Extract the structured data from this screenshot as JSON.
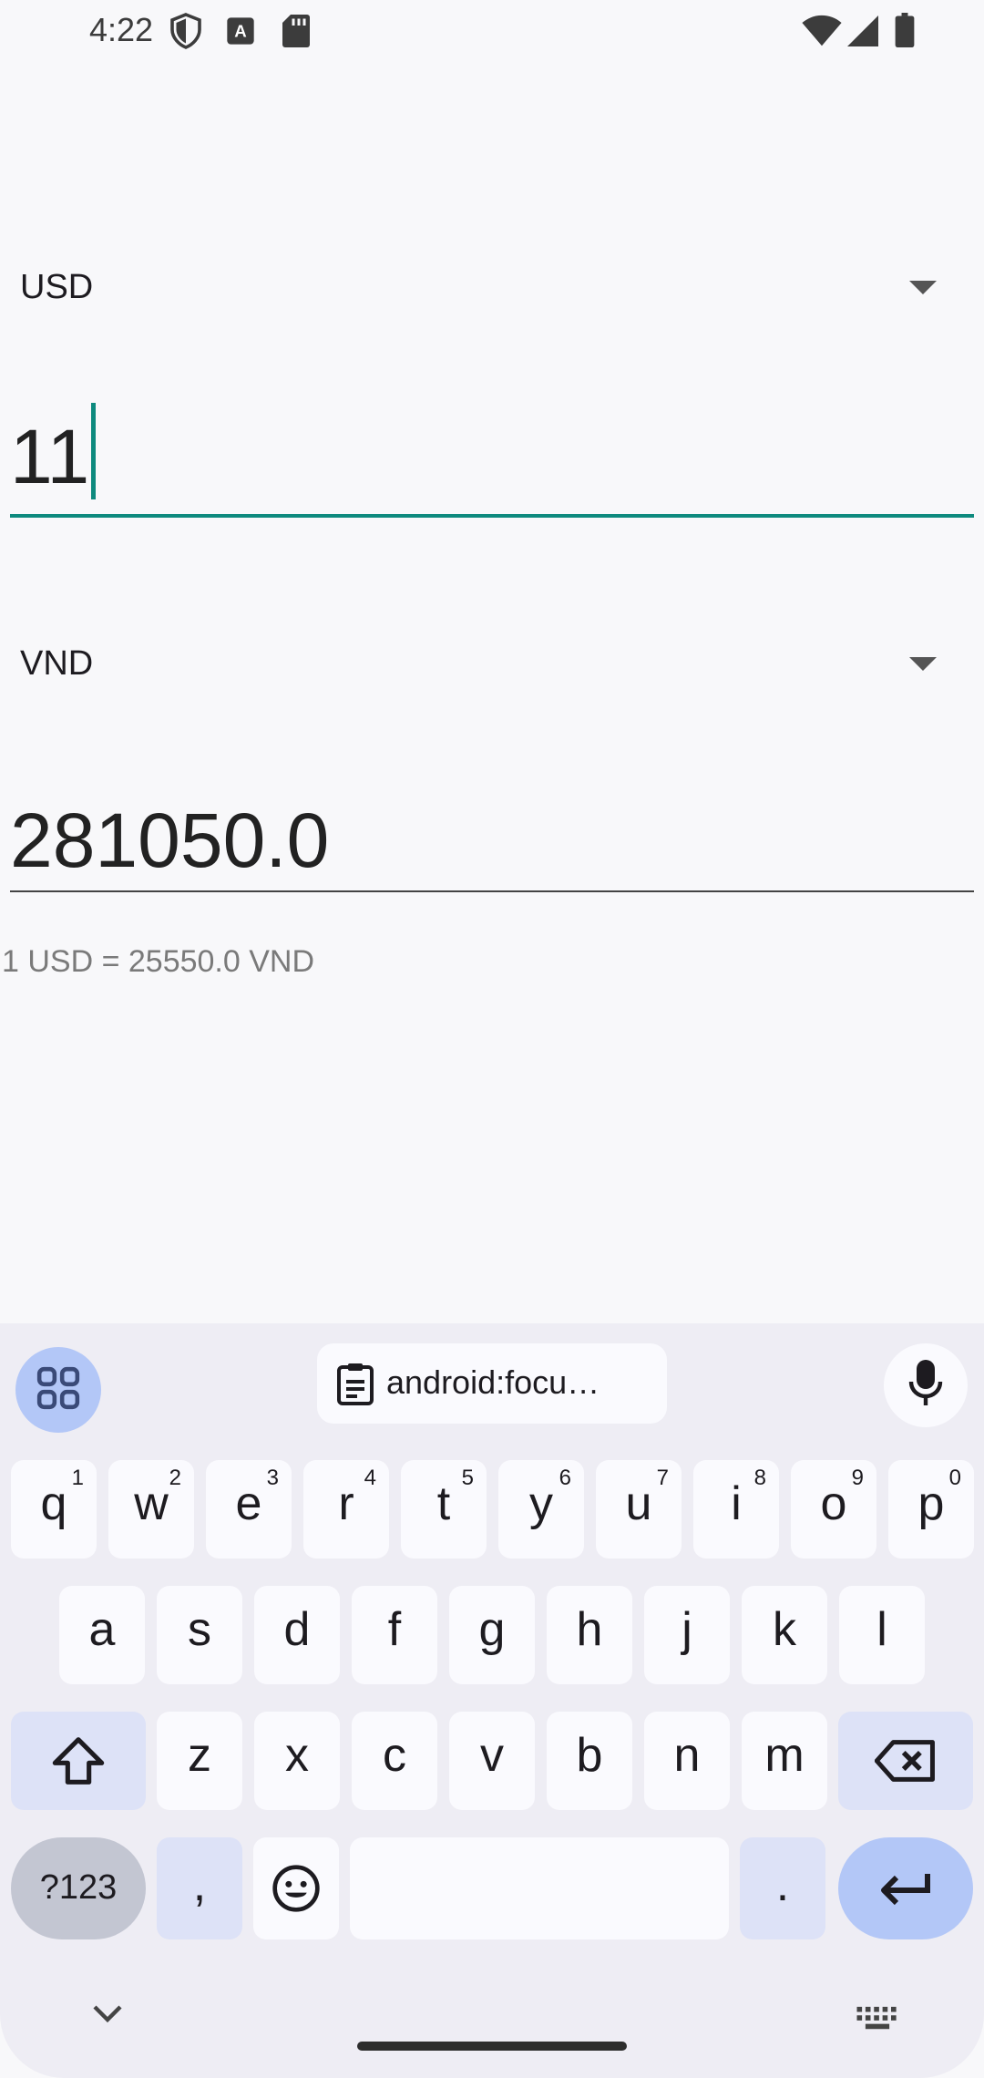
{
  "status_bar": {
    "time": "4:22",
    "left_icons": [
      "shield-icon",
      "font-a-icon",
      "sd-card-icon"
    ],
    "right_icons": [
      "wifi-icon",
      "signal-icon",
      "battery-icon"
    ]
  },
  "converter": {
    "from_currency": "USD",
    "from_amount": "11",
    "to_currency": "VND",
    "to_amount": "281050.0",
    "rate_text": "1 USD = 25550.0 VND",
    "accent_color": "#0e8a7e"
  },
  "keyboard": {
    "clipboard_text": "android:focu…",
    "row1": [
      {
        "label": "q",
        "hint": "1"
      },
      {
        "label": "w",
        "hint": "2"
      },
      {
        "label": "e",
        "hint": "3"
      },
      {
        "label": "r",
        "hint": "4"
      },
      {
        "label": "t",
        "hint": "5"
      },
      {
        "label": "y",
        "hint": "6"
      },
      {
        "label": "u",
        "hint": "7"
      },
      {
        "label": "i",
        "hint": "8"
      },
      {
        "label": "o",
        "hint": "9"
      },
      {
        "label": "p",
        "hint": "0"
      }
    ],
    "row2": [
      "a",
      "s",
      "d",
      "f",
      "g",
      "h",
      "j",
      "k",
      "l"
    ],
    "row3": [
      "z",
      "x",
      "c",
      "v",
      "b",
      "n",
      "m"
    ],
    "symbols_label": "?123",
    "comma_label": ",",
    "period_label": "."
  }
}
